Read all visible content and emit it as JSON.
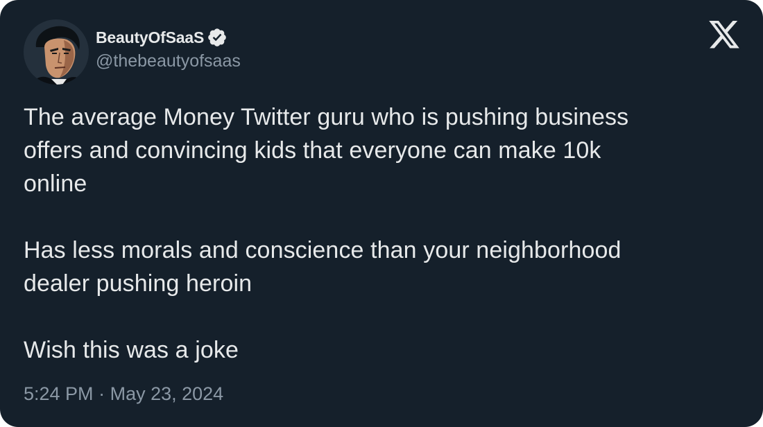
{
  "author": {
    "display_name": "BeautyOfSaaS",
    "handle": "@thebeautyofsaas",
    "verified": true,
    "avatar_icon": "avatar-icon"
  },
  "tweet": {
    "paragraphs": [
      "The average Money Twitter guru who is pushing business\noffers and convincing kids that everyone can make 10k\nonline",
      "Has less morals and conscience than your neighborhood\ndealer pushing heroin",
      "Wish this was a joke"
    ],
    "time": "5:24 PM",
    "separator": "·",
    "date": "May 23, 2024"
  },
  "brand": {
    "logo_icon": "x-logo-icon"
  },
  "colors": {
    "background": "#15202b",
    "text": "#e7e9ea",
    "secondary_text": "#8b98a5",
    "verified_badge": "#e7e9ea"
  }
}
